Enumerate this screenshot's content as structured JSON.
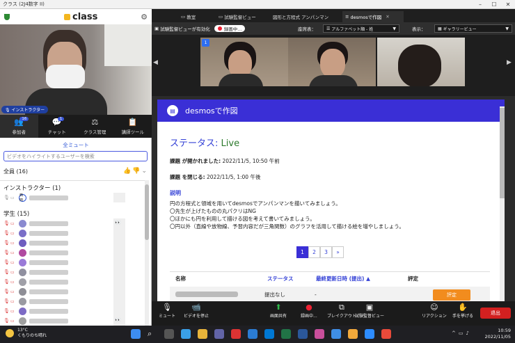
{
  "window": {
    "title": "クラス (2J4数字 II)"
  },
  "left": {
    "brand": "class",
    "instructor_tag": "インストラクター",
    "tabs": [
      {
        "label": "参加者",
        "badge": "16"
      },
      {
        "label": "チャット",
        "badge": "1"
      },
      {
        "label": "クラス管理",
        "badge": ""
      },
      {
        "label": "講師ツール",
        "badge": ""
      }
    ],
    "mute_all": "全ミュート",
    "highlight_placeholder": "ビデオをハイライトするユーザーを検索",
    "all_label": "全員 (16)",
    "section_instructor": "インストラクター (1)",
    "instructor_avatar": "西田",
    "section_students": "学生 (15)",
    "eyes": "👀"
  },
  "right": {
    "tabs": [
      "教室",
      "試験監督ビュー",
      "図形と方程式 アンパンマン",
      "desmosで作図"
    ],
    "proctor_label": "試験監督ビューが有効化",
    "rec_label": "録画中...",
    "sort_label": "座席表：",
    "sort_value": "アルファベット順 - 姓",
    "view_label": "表示：",
    "view_value": "ギャラリービュー",
    "gallery_badge": "1"
  },
  "doc": {
    "header": "desmosで作図",
    "status_label": "ステータス:",
    "status_value": "Live",
    "opened_label": "課題 が開かれました:",
    "opened_value": "2022/11/5, 10:50 午前",
    "closes_label": "課題 を閉じる:",
    "closes_value": "2022/11/5, 1:00 午後",
    "desc_heading": "説明",
    "desc_lines": [
      "円の方程式と領域を用いてdesmosでアンパンマンを描いてみましょう。",
      "〇先生が上げたものの丸パクリはNG",
      "〇ほかにも円を利用して描ける図を考えて書いてみましょう。",
      "〇円以外（直線や放物線、予習内容だが三角関数）のグラフを活用して描ける絵を増やしましょう。"
    ],
    "pages": [
      "1",
      "2",
      "3",
      "»"
    ],
    "col_name": "名称",
    "col_status": "ステータス",
    "col_updated": "最終更新日時 (提出)",
    "col_grade": "評定",
    "row_status": "提出なし",
    "row_updated": "-",
    "row_button": "評定"
  },
  "toolbar": {
    "items": [
      "ミュート",
      "ビデオを停止",
      "画面共有",
      "録画中...",
      "ブレイクアウト",
      "試験監督ビュー",
      "リアクション",
      "手を挙げる"
    ],
    "leave": "退出"
  },
  "taskbar": {
    "temp": "13°C",
    "weather": "くもりのち晴れ",
    "time": "10:59",
    "date": "2022/11/05"
  },
  "colors": {
    "accent": "#3a2fd6",
    "leave": "#d32020",
    "button": "#f28c1e",
    "live": "#2c7a2c"
  }
}
